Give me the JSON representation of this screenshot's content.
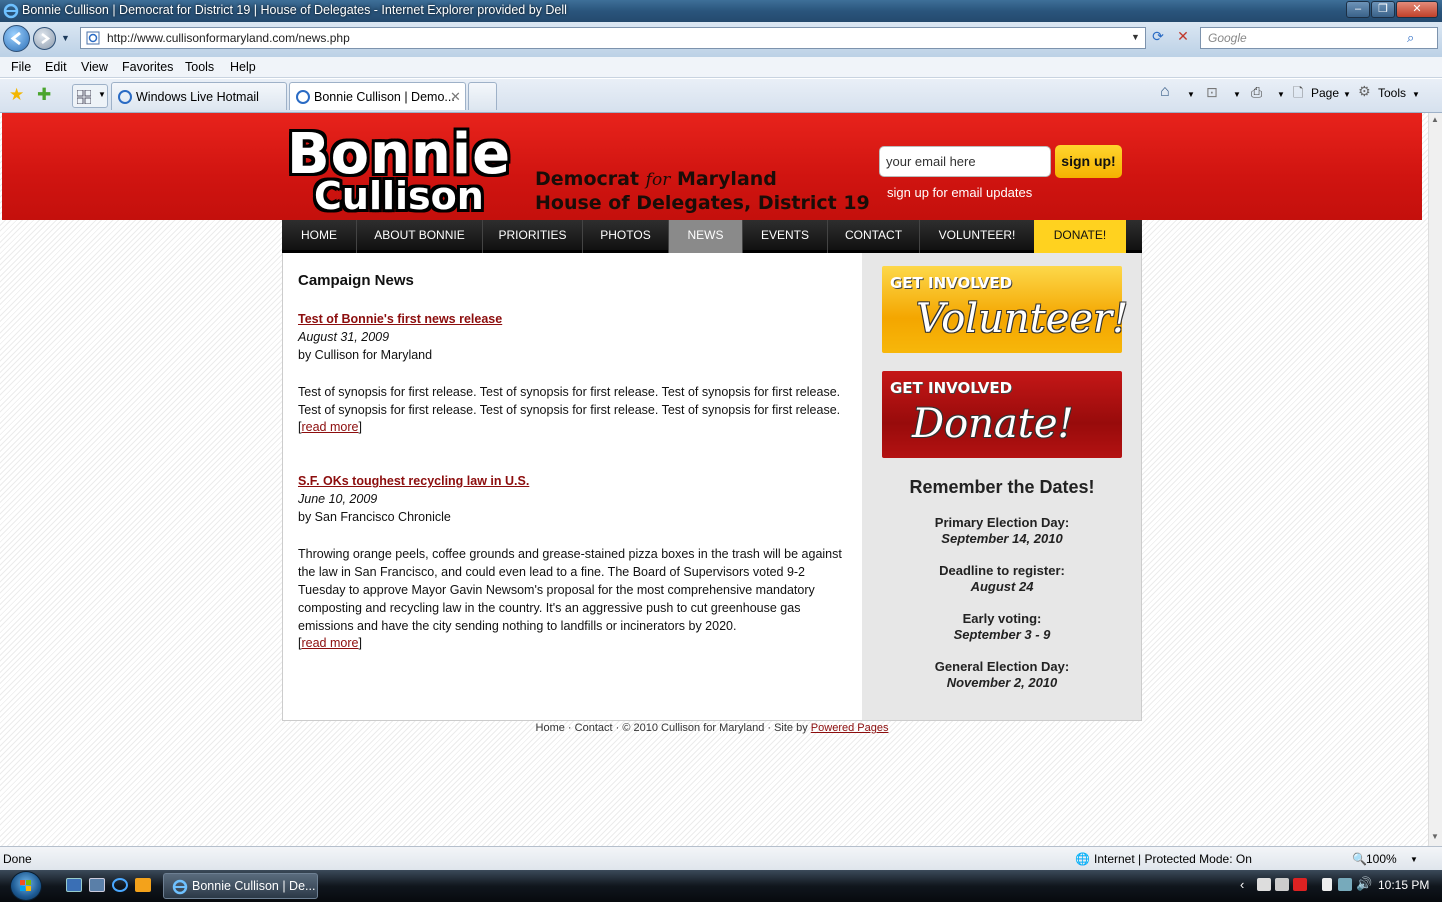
{
  "window": {
    "title": "Bonnie Cullison | Democrat for District 19 | House of Delegates - Internet Explorer provided by Dell"
  },
  "addressbar": {
    "url": "http://www.cullisonformaryland.com/news.php",
    "search_placeholder": "Google"
  },
  "menu": [
    "File",
    "Edit",
    "View",
    "Favorites",
    "Tools",
    "Help"
  ],
  "tabs": [
    {
      "label": "Windows Live Hotmail"
    },
    {
      "label": "Bonnie Cullison | Demo..."
    }
  ],
  "commandbar": {
    "page": "Page",
    "tools": "Tools"
  },
  "site": {
    "logo_first": "Bonnie",
    "logo_last": "Cullison",
    "tagline1_a": "Democrat",
    "tagline1_for": "for",
    "tagline1_b": "Maryland",
    "tagline2": "House of Delegates, District 19",
    "email_value": "your email here",
    "signup_button": "sign up!",
    "signup_note": "sign up for email updates",
    "nav": [
      "HOME",
      "ABOUT BONNIE",
      "PRIORITIES",
      "PHOTOS",
      "NEWS",
      "EVENTS",
      "CONTACT",
      "VOLUNTEER!",
      "DONATE!"
    ],
    "heading": "Campaign News",
    "articles": [
      {
        "title": "Test of Bonnie's first news release",
        "date": "August 31, 2009",
        "by": "by Cullison for Maryland",
        "body": "Test of synopsis for first release. Test of synopsis for first release. Test of synopsis for first release. Test of synopsis for first release. Test of synopsis for first release. Test of synopsis for first release.",
        "more": "read more"
      },
      {
        "title": "S.F. OKs toughest recycling law in U.S.",
        "date": "June 10, 2009",
        "by": "by San Francisco Chronicle",
        "body": "Throwing orange peels, coffee grounds and grease-stained pizza boxes in the trash will be against the law in San Francisco, and could even lead to a fine. The Board of Supervisors voted 9-2 Tuesday to approve Mayor Gavin Newsom's proposal for the most comprehensive mandatory composting and recycling law in the country. It's an aggressive push to cut greenhouse gas emissions and have the city sending nothing to landfills or incinerators by 2020.",
        "more": "read more"
      }
    ],
    "promos": {
      "volunteer_top": "GET INVOLVED",
      "volunteer_script": "Volunteer!",
      "donate_top": "GET INVOLVED",
      "donate_script": "Donate!"
    },
    "dates_heading": "Remember the Dates!",
    "dates": [
      {
        "label": "Primary Election Day:",
        "value": "September 14, 2010"
      },
      {
        "label": "Deadline to register:",
        "value": "August 24"
      },
      {
        "label": "Early voting:",
        "value": "September 3 - 9"
      },
      {
        "label": "General Election Day:",
        "value": "November 2, 2010"
      }
    ],
    "footer_text": "Home · Contact · © 2010 Cullison for Maryland · Site by",
    "footer_link": "Powered Pages"
  },
  "status": {
    "left": "Done",
    "zone": "Internet | Protected Mode: On",
    "zoom": "100%"
  },
  "taskbar": {
    "task": "Bonnie Cullison | De...",
    "clock": "10:15 PM"
  },
  "colors": {
    "brand_red": "#d01410",
    "donate_yellow": "#ffd21f",
    "link_red": "#8c0d0d"
  }
}
